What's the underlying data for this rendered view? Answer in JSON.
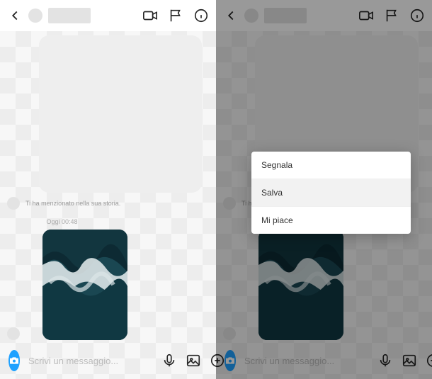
{
  "header": {
    "back_icon": "back",
    "video_icon": "video-call",
    "flag_icon": "flag",
    "info_icon": "info"
  },
  "convo": {
    "mention_text": "Ti ha menzionato nella sua storia.",
    "timestamp": "Oggi 00:48"
  },
  "footer": {
    "input_placeholder": "Scrivi un messaggio...",
    "mic_icon": "mic",
    "gallery_icon": "gallery",
    "plus_icon": "add"
  },
  "menu": {
    "items": [
      {
        "label": "Segnala",
        "selected": false
      },
      {
        "label": "Salva",
        "selected": true
      },
      {
        "label": "Mi piace",
        "selected": false
      }
    ]
  },
  "colors": {
    "accent": "#1fa1ff",
    "icon": "#262626",
    "muted": "#999"
  }
}
